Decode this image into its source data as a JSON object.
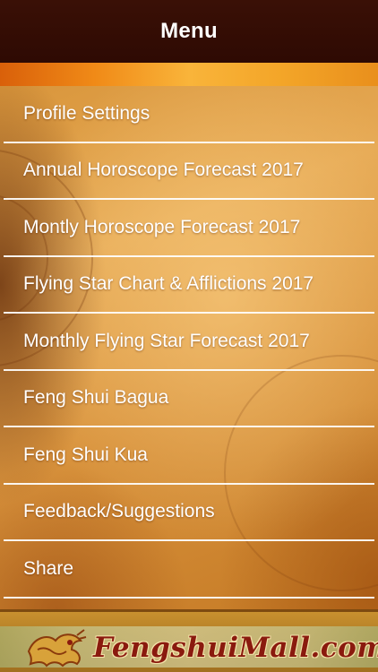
{
  "header": {
    "title": "Menu"
  },
  "menu": {
    "items": [
      {
        "label": "Profile Settings"
      },
      {
        "label": "Annual Horoscope Forecast 2017"
      },
      {
        "label": "Montly Horoscope Forecast 2017"
      },
      {
        "label": "Flying Star Chart & Afflictions 2017"
      },
      {
        "label": "Monthly Flying Star Forecast 2017"
      },
      {
        "label": "Feng Shui Bagua"
      },
      {
        "label": "Feng Shui Kua"
      },
      {
        "label": "Feedback/Suggestions"
      },
      {
        "label": "Share"
      }
    ]
  },
  "footer": {
    "brand": "FengshuiMall.com"
  },
  "colors": {
    "header_bg": "#3a1006",
    "accent_orange": "#f08a17",
    "brand_red": "#8a1a0e",
    "menu_text": "#ffffff"
  }
}
